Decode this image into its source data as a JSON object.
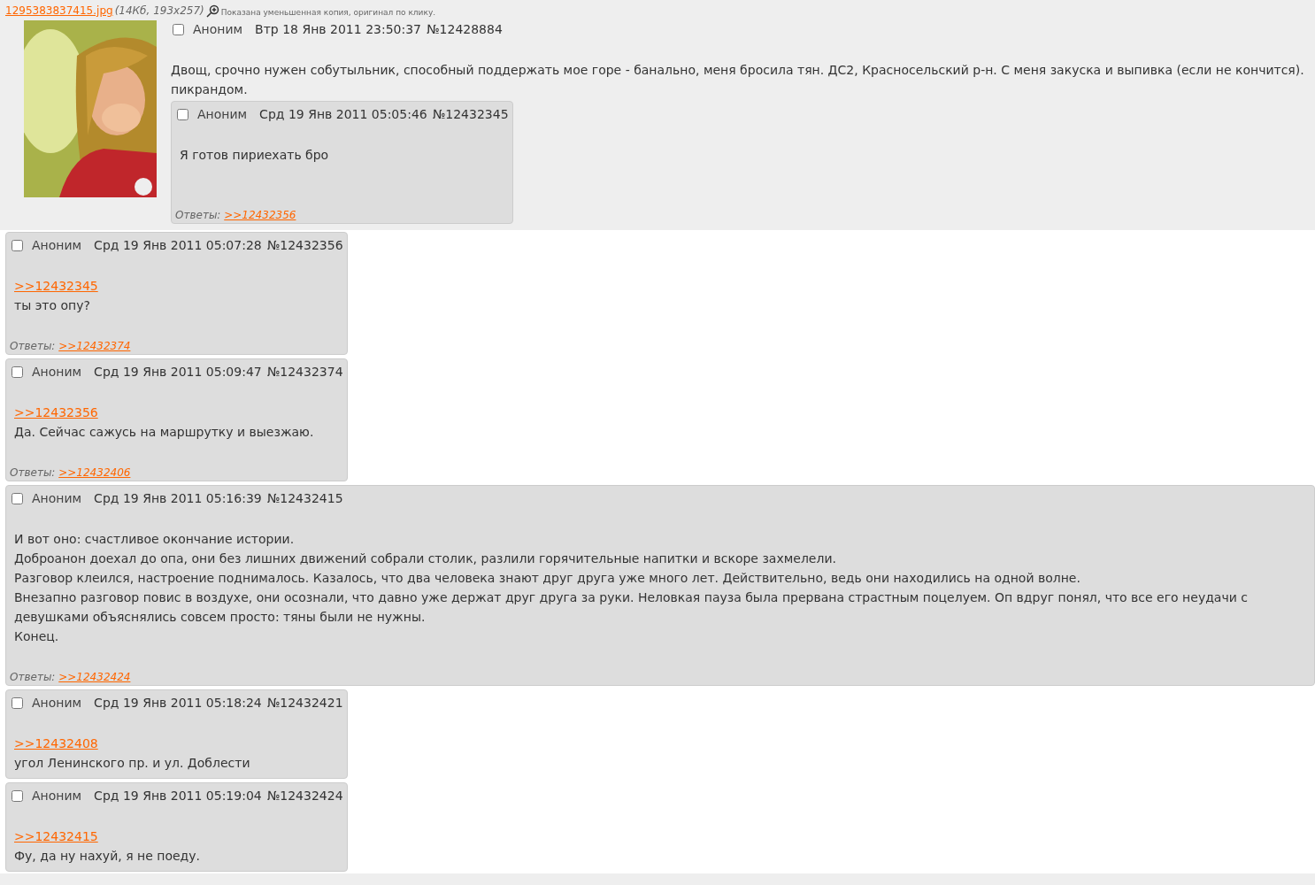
{
  "op": {
    "file": {
      "name": "1295383837415.jpg",
      "info": "(14Кб, 193x257)",
      "hint": "Показана уменьшенная копия, оригинал по клику."
    },
    "post": {
      "checked": false,
      "author": "Аноним",
      "date": "Втр 18 Янв 2011 23:50:37",
      "number": "№12428884",
      "body": [
        {
          "kind": "text",
          "text": "Двощ, срочно нужен собутыльник, способный поддержать мое горе - банально, меня бросила тян. ДС2, Красносельский р-н. С меня закуска и выпивка (если не кончится). пикрандом."
        }
      ]
    },
    "replies": [
      {
        "checked": false,
        "author": "Аноним",
        "date": "Срд 19 Янв 2011 05:05:46",
        "number": "№12432345",
        "body": [
          {
            "kind": "text",
            "text": "Я готов пириехать бро"
          }
        ],
        "answers_label": "Ответы:",
        "answers": [
          ">>12432356"
        ]
      }
    ]
  },
  "posts": [
    {
      "checked": false,
      "author": "Аноним",
      "date": "Срд 19 Янв 2011 05:07:28",
      "number": "№12432356",
      "body": [
        {
          "kind": "link",
          "text": ">>12432345"
        },
        {
          "kind": "text",
          "text": "ты это опу?"
        }
      ],
      "answers_label": "Ответы:",
      "answers": [
        ">>12432374"
      ]
    },
    {
      "checked": false,
      "author": "Аноним",
      "date": "Срд 19 Янв 2011 05:09:47",
      "number": "№12432374",
      "body": [
        {
          "kind": "link",
          "text": ">>12432356"
        },
        {
          "kind": "text",
          "text": "Да. Сейчас сажусь на маршрутку и выезжаю."
        }
      ],
      "answers_label": "Ответы:",
      "answers": [
        ">>12432406"
      ]
    },
    {
      "checked": false,
      "author": "Аноним",
      "date": "Срд 19 Янв 2011 05:16:39",
      "number": "№12432415",
      "body": [
        {
          "kind": "text",
          "text": "И вот оно: счастливое окончание истории."
        },
        {
          "kind": "text",
          "text": "Доброанон доехал до опа, они без лишних движений собрали столик, разлили горячительные напитки и вскоре захмелели."
        },
        {
          "kind": "text",
          "text": "Разговор клеился, настроение поднималось. Казалось, что два человека знают друг друга уже много лет. Действительно, ведь они находились на одной волне."
        },
        {
          "kind": "text",
          "text": "Внезапно разговор повис в воздухе, они осознали, что давно уже держат друг друга за руки. Неловкая пауза была прервана страстным поцелуем. Оп вдруг понял, что все его неудачи с девушками объяснялись совсем просто: тяны были не нужны."
        },
        {
          "kind": "text",
          "text": "Конец."
        }
      ],
      "answers_label": "Ответы:",
      "answers": [
        ">>12432424"
      ]
    },
    {
      "checked": false,
      "author": "Аноним",
      "date": "Срд 19 Янв 2011 05:18:24",
      "number": "№12432421",
      "body": [
        {
          "kind": "link",
          "text": ">>12432408"
        },
        {
          "kind": "text",
          "text": "угол Ленинского пр. и ул. Доблести"
        }
      ]
    },
    {
      "checked": false,
      "author": "Аноним",
      "date": "Срд 19 Янв 2011 05:19:04",
      "number": "№12432424",
      "body": [
        {
          "kind": "link",
          "text": ">>12432415"
        },
        {
          "kind": "text",
          "text": "Фу, да ну нахуй, я не поеду."
        }
      ]
    }
  ]
}
